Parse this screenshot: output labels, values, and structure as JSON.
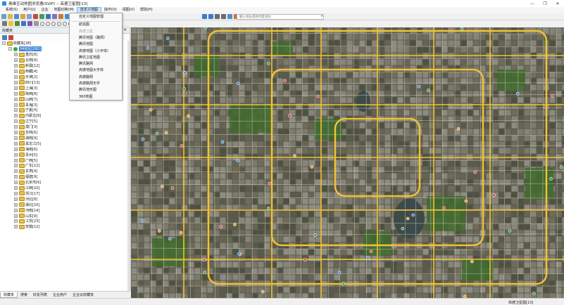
{
  "window": {
    "title": "奥维互动地图浏览器(SVIP) -- 高德卫星图[13]",
    "controls": [
      "—",
      "❐",
      "✕"
    ]
  },
  "menu": [
    "系统(S)",
    "用户(U)",
    "企业",
    "地图切换(M)",
    "自定义地图",
    "操作(O)",
    "视图(V)",
    "帮助(H)"
  ],
  "search": {
    "placeholder": "输入地址或经纬度坐标"
  },
  "panel": {
    "title": "收藏夹",
    "close": "✕"
  },
  "tree": {
    "root": {
      "expander": "−",
      "label": "收藏夹[28]"
    },
    "group": {
      "expander": "−",
      "label": "34省区[292]"
    },
    "provinces": [
      "重庆[8]",
      "云南[9]",
      "新疆[12]",
      "西藏[4]",
      "天津[2]",
      "四川[13]",
      "上海[3]",
      "陕西[8]",
      "山西[7]",
      "青海[3]",
      "宁夏[4]",
      "内蒙古[8]",
      "辽宁[5]",
      "澳门[3]",
      "吉林[6]",
      "湖南[9]",
      "黑龙江[5]",
      "海南[6]",
      "贵州[5]",
      "广西[5]",
      "广东[12]",
      "甘肃[4]",
      "福建[9]",
      "北京市[6]",
      "江西[10]",
      "浙江[17]",
      "河北[8]",
      "湖北[10]",
      "河南[14]",
      "山东[9]",
      "江苏[23]",
      "安徽[12]"
    ],
    "province_expander": "+"
  },
  "bottom_tabs": [
    "收藏夹",
    "搜索",
    "好友列表",
    "企业用户",
    "企业云收藏夹"
  ],
  "status": {
    "zoom_text": "高德卫星图[13]"
  },
  "dropdown": {
    "items": [
      {
        "label": "自定义地图管理",
        "disabled": false
      },
      {
        "label": "航拍图",
        "disabled": false
      },
      {
        "label": "高德卫星",
        "disabled": true
      },
      {
        "label": "腾讯地图（路网）",
        "disabled": false
      },
      {
        "label": "腾讯地图",
        "disabled": false
      },
      {
        "label": "高德地图（小字体）",
        "disabled": false
      },
      {
        "label": "腾讯卫星地图",
        "disabled": false
      },
      {
        "label": "腾讯路网",
        "disabled": false
      },
      {
        "label": "高德地图大字体",
        "disabled": false
      },
      {
        "label": "高德路网",
        "disabled": false
      },
      {
        "label": "高德路网无字",
        "disabled": false
      },
      {
        "label": "腾讯地形图",
        "disabled": false
      },
      {
        "label": "360地图",
        "disabled": false
      }
    ]
  },
  "colors": {
    "selection": "#3b83d6",
    "map_ground": "#5c5b4a",
    "road_major": "#f2c233",
    "road_minor": "#d8d3c2",
    "vegetation": "#3f6a2c"
  }
}
